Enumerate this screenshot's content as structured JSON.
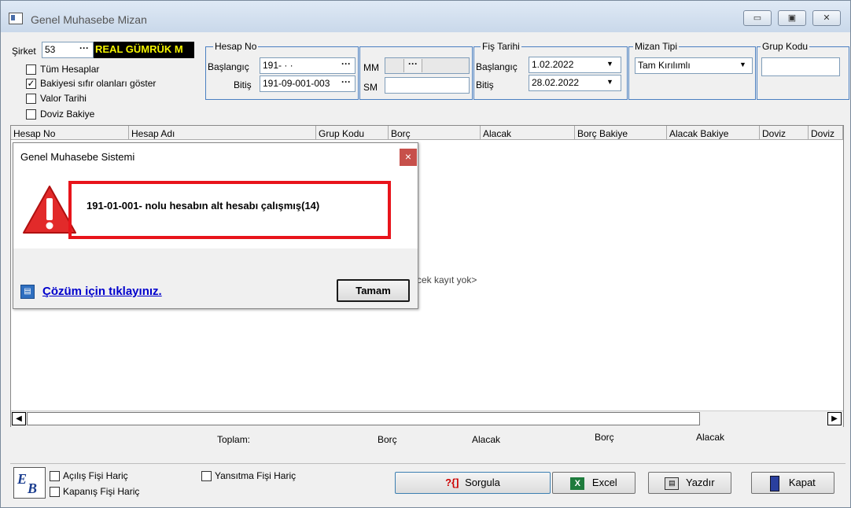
{
  "window": {
    "title": "Genel Muhasebe Mizan",
    "min_glyph": "▭",
    "max_glyph": "▣",
    "close_glyph": "✕"
  },
  "filters": {
    "sirket_label": "Şirket",
    "sirket_value": "53",
    "company_name": "REAL GÜMRÜK M",
    "dots": "···",
    "checkboxes": [
      {
        "label": "Tüm Hesaplar",
        "checked": false
      },
      {
        "label": "Bakiyesi sıfır olanları göster",
        "checked": true
      },
      {
        "label": "Valor Tarihi",
        "checked": false
      },
      {
        "label": "Doviz Bakiye",
        "checked": false
      }
    ],
    "hesap_no": {
      "title": "Hesap No",
      "baslangic_label": "Başlangıç",
      "baslangic_value": "191-  ·   ·",
      "bitis_label": "Bitiş",
      "bitis_value": "191-09-001-003"
    },
    "mm_label": "MM",
    "sm_label": "SM",
    "fis_tarihi": {
      "title": "Fiş Tarihi",
      "baslangic_label": "Başlangıç",
      "baslangic_value": "1.02.2022",
      "bitis_label": "Bitiş",
      "bitis_value": "28.02.2022"
    },
    "mizan_tipi": {
      "title": "Mizan Tipi",
      "value": "Tam Kırılımlı"
    },
    "grup_kodu": {
      "title": "Grup Kodu"
    }
  },
  "grid": {
    "columns": [
      "Hesap No",
      "Hesap Adı",
      "Grup Kodu",
      "Borç",
      "Alacak",
      "Borç Bakiye",
      "Alacak Bakiye",
      "Doviz",
      "Doviz"
    ],
    "empty_text": "cek kayıt yok>"
  },
  "dialog": {
    "title": "Genel Muhasebe Sistemi",
    "close_glyph": "×",
    "message": "191-01-001- nolu hesabın alt hesabı çalışmış(14)",
    "help_link": "Çözüm için tıklayınız.",
    "ok_label": "Tamam"
  },
  "totals": {
    "label": "Toplam:",
    "borc1": "Borç",
    "alacak1": "Alacak",
    "borc2": "Borç",
    "alacak2": "Alacak"
  },
  "bottom": {
    "checkboxes": [
      {
        "label": "Açılış Fişi Hariç",
        "checked": false
      },
      {
        "label": "Kapanış Fişi Hariç",
        "checked": false
      },
      {
        "label": "Yansıtma Fişi Hariç",
        "checked": false
      }
    ],
    "buttons": {
      "sorgula": "Sorgula",
      "excel": "Excel",
      "yazdir": "Yazdır",
      "kapat": "Kapat"
    }
  },
  "colors": {
    "highlight_red": "#e8141b",
    "link_blue": "#0000cc",
    "group_border": "#4a7fc1",
    "company_yellow": "#f5f500"
  }
}
